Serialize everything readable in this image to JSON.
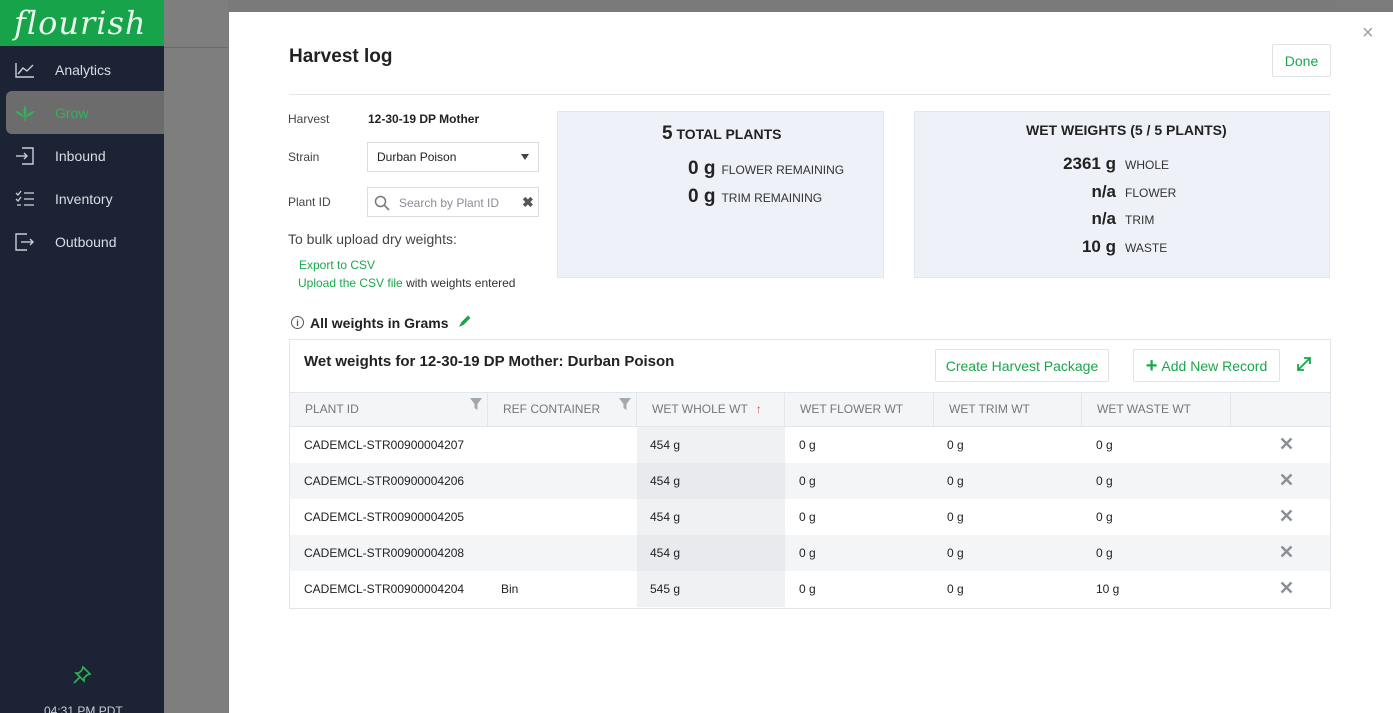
{
  "sidebar": {
    "logo": "flourish",
    "items": [
      {
        "label": "Analytics",
        "icon": "analytics-icon"
      },
      {
        "label": "Grow",
        "icon": "leaf-icon"
      },
      {
        "label": "Inbound",
        "icon": "inbound-icon"
      },
      {
        "label": "Inventory",
        "icon": "inventory-icon"
      },
      {
        "label": "Outbound",
        "icon": "outbound-icon"
      }
    ],
    "time": "04:31 PM PDT"
  },
  "modal": {
    "title": "Harvest log",
    "done_label": "Done",
    "close_label": "×",
    "harvest_label": "Harvest",
    "harvest_value": "12-30-19 DP Mother",
    "strain_label": "Strain",
    "strain_value": "Durban Poison",
    "plant_id_label": "Plant ID",
    "plant_id_placeholder": "Search by Plant ID",
    "bulk_text": "To bulk upload dry weights:",
    "export_link": "Export to CSV",
    "upload_link": "Upload the CSV file",
    "upload_suffix": " with weights entered",
    "totals": {
      "plants_count": "5",
      "plants_label": "TOTAL PLANTS",
      "flower_remaining_value": "0 g",
      "flower_remaining_label": "FLOWER REMAINING",
      "trim_remaining_value": "0 g",
      "trim_remaining_label": "TRIM REMAINING"
    },
    "wet_weights": {
      "title": "WET WEIGHTS (5 / 5 PLANTS)",
      "whole_value": "2361 g",
      "whole_label": "WHOLE",
      "flower_value": "n/a",
      "flower_label": "FLOWER",
      "trim_value": "n/a",
      "trim_label": "TRIM",
      "waste_value": "10 g",
      "waste_label": "WASTE"
    },
    "units_note": "All weights in Grams",
    "table": {
      "title": "Wet weights for 12-30-19 DP Mother: Durban Poison",
      "create_package_label": "Create Harvest Package",
      "add_record_label": "Add New Record",
      "columns": [
        "PLANT ID",
        "REF CONTAINER",
        "WET WHOLE WT",
        "WET FLOWER WT",
        "WET TRIM WT",
        "WET WASTE WT"
      ],
      "rows": [
        {
          "plant_id": "CADEMCL-STR00900004207",
          "ref": "",
          "whole": "454 g",
          "flower": "0 g",
          "trim": "0 g",
          "waste": "0 g"
        },
        {
          "plant_id": "CADEMCL-STR00900004206",
          "ref": "",
          "whole": "454 g",
          "flower": "0 g",
          "trim": "0 g",
          "waste": "0 g"
        },
        {
          "plant_id": "CADEMCL-STR00900004205",
          "ref": "",
          "whole": "454 g",
          "flower": "0 g",
          "trim": "0 g",
          "waste": "0 g"
        },
        {
          "plant_id": "CADEMCL-STR00900004208",
          "ref": "",
          "whole": "454 g",
          "flower": "0 g",
          "trim": "0 g",
          "waste": "0 g"
        },
        {
          "plant_id": "CADEMCL-STR00900004204",
          "ref": "Bin",
          "whole": "545 g",
          "flower": "0 g",
          "trim": "0 g",
          "waste": "10 g"
        }
      ]
    }
  },
  "colors": {
    "accent": "#19a74a",
    "sidebar_bg": "#1b2335",
    "sort_arrow": "#e14c4c"
  }
}
